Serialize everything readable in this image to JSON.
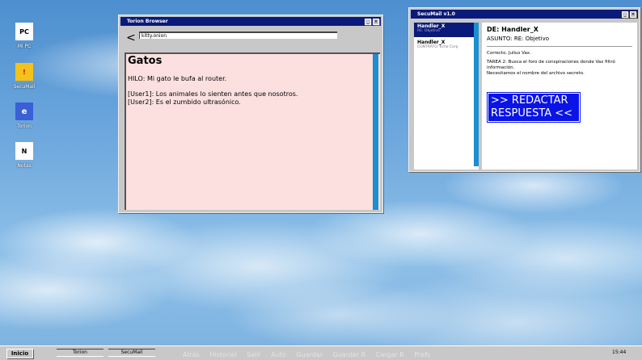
{
  "desktop": {
    "icons": [
      {
        "glyph": "PC",
        "label": "Mi PC",
        "icon": "computer-icon"
      },
      {
        "glyph": "!",
        "label": "SecuMail",
        "icon": "mail-warning-icon"
      },
      {
        "glyph": "e",
        "label": "Torion",
        "icon": "browser-icon"
      },
      {
        "glyph": "N",
        "label": "Notas",
        "icon": "notes-icon"
      }
    ]
  },
  "browser": {
    "title": "Torion Browser",
    "back_label": "<",
    "url": "kitty.onion",
    "page": {
      "heading": "Gatos",
      "thread": "HILO: Mi gato le bufa al router.",
      "posts": [
        "[User1]: Los animales lo sienten antes que nosotros.",
        "[User2]: Es el zumbido ultrasónico."
      ]
    },
    "colors": {
      "page_bg": "#fce0e0",
      "scrollbar": "#1b8fd0"
    }
  },
  "mail": {
    "title": "SecuMail v1.0",
    "list": [
      {
        "from": "Handler_X",
        "subject": "RE: Objetivo",
        "selected": true
      },
      {
        "from": "Handler_X",
        "subject": "CONTRATO: Echo Corp",
        "selected": false
      }
    ],
    "view": {
      "from": "DE: Handler_X",
      "subject": "ASUNTO: RE: Objetivo",
      "to": "Correcto. Julius Vax.",
      "body_lines": [
        "TAREA 2: Busca el foro de conspiraciones donde Vax filtró",
        "información.",
        "Necesitamos el nombre del archivo secreto."
      ],
      "reply_line1": ">> REDACTAR",
      "reply_line2": "RESPUESTA <<"
    },
    "colors": {
      "selected": "#0a1a7a",
      "reply_bg": "#0a14e6"
    }
  },
  "taskbar": {
    "start_label": "Inicio",
    "tasks": [
      "Torion",
      "SecuMail"
    ],
    "menu_ghost": [
      "Atrás",
      "Historial",
      "Salir",
      "Auto",
      "Guardar",
      "Guardar R",
      "Cargar R",
      "Prefs"
    ],
    "clock": "15:44"
  },
  "window_buttons": {
    "minimize": "_",
    "close": "×"
  }
}
